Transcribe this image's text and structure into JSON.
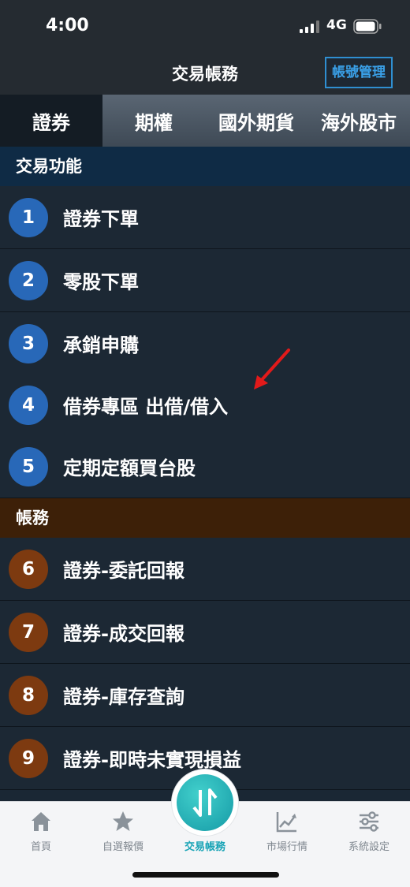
{
  "status_bar": {
    "time": "4:00",
    "network": "4G"
  },
  "header": {
    "title": "交易帳務",
    "account_button": "帳號管理"
  },
  "tabs": [
    {
      "label": "證券",
      "active": true
    },
    {
      "label": "期權",
      "active": false
    },
    {
      "label": "國外期貨",
      "active": false
    },
    {
      "label": "海外股市",
      "active": false
    }
  ],
  "sections": {
    "trade": {
      "title": "交易功能",
      "items": [
        {
          "number": "1",
          "label": "證券下單"
        },
        {
          "number": "2",
          "label": "零股下單"
        },
        {
          "number": "3",
          "label": "承銷申購"
        },
        {
          "number": "4",
          "label": "借券專區 出借/借入"
        },
        {
          "number": "5",
          "label": "定期定額買台股"
        }
      ]
    },
    "account": {
      "title": "帳務",
      "items": [
        {
          "number": "6",
          "label": "證券-委託回報"
        },
        {
          "number": "7",
          "label": "證券-成交回報"
        },
        {
          "number": "8",
          "label": "證券-庫存查詢"
        },
        {
          "number": "9",
          "label": "證券-即時未實現損益"
        }
      ]
    }
  },
  "bottom_nav": [
    {
      "label": "首頁",
      "icon": "home-icon"
    },
    {
      "label": "自選報價",
      "icon": "star-icon"
    },
    {
      "label": "交易帳務",
      "icon": "transfer-icon",
      "active": true
    },
    {
      "label": "市場行情",
      "icon": "chart-icon"
    },
    {
      "label": "系統設定",
      "icon": "settings-icon"
    }
  ],
  "colors": {
    "accent": "#19a4b6",
    "trade_badge": "#2868b8",
    "account_badge": "#7d3a10",
    "annotation_arrow": "#e21a1a"
  }
}
